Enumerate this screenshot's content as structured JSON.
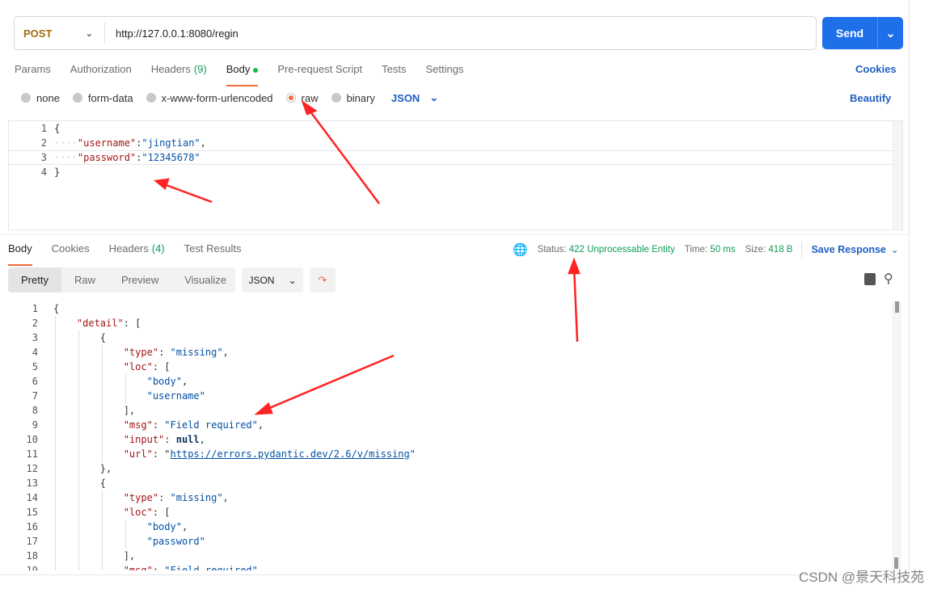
{
  "request": {
    "method": "POST",
    "url": "http://127.0.0.1:8080/regin",
    "send_label": "Send"
  },
  "request_tabs": [
    {
      "label": "Params"
    },
    {
      "label": "Authorization"
    },
    {
      "label": "Headers",
      "count": "(9)"
    },
    {
      "label": "Body",
      "active": true
    },
    {
      "label": "Pre-request Script"
    },
    {
      "label": "Tests"
    },
    {
      "label": "Settings"
    }
  ],
  "cookies_label": "Cookies",
  "body_types": [
    {
      "label": "none"
    },
    {
      "label": "form-data"
    },
    {
      "label": "x-www-form-urlencoded"
    },
    {
      "label": "raw",
      "selected": true
    },
    {
      "label": "binary"
    }
  ],
  "body_format": "JSON",
  "beautify_label": "Beautify",
  "request_body": [
    [
      [
        "p",
        "{"
      ]
    ],
    [
      [
        "ws",
        "····"
      ],
      [
        "k",
        "\"username\""
      ],
      [
        "p",
        ":"
      ],
      [
        "s",
        "\"jingtian\""
      ],
      [
        "p",
        ","
      ]
    ],
    [
      [
        "ws",
        "····"
      ],
      [
        "k",
        "\"password\""
      ],
      [
        "p",
        ":"
      ],
      [
        "s",
        "\"12345678\""
      ]
    ],
    [
      [
        "p",
        "}"
      ]
    ]
  ],
  "response_tabs": [
    {
      "label": "Body",
      "active": true
    },
    {
      "label": "Cookies"
    },
    {
      "label": "Headers",
      "count": "(4)"
    },
    {
      "label": "Test Results"
    }
  ],
  "status": {
    "status_label": "Status:",
    "status_value": "422 Unprocessable Entity",
    "time_label": "Time:",
    "time_value": "50 ms",
    "size_label": "Size:",
    "size_value": "418 B",
    "save_label": "Save Response"
  },
  "view_modes": [
    {
      "label": "Pretty",
      "active": true
    },
    {
      "label": "Raw"
    },
    {
      "label": "Preview"
    },
    {
      "label": "Visualize"
    }
  ],
  "response_format": "JSON",
  "response_body": [
    [
      [
        "p",
        "{"
      ]
    ],
    [
      [
        "p",
        "    "
      ],
      [
        "k",
        "\"detail\""
      ],
      [
        "p",
        ": ["
      ]
    ],
    [
      [
        "p",
        "        {"
      ]
    ],
    [
      [
        "p",
        "            "
      ],
      [
        "k",
        "\"type\""
      ],
      [
        "p",
        ": "
      ],
      [
        "s",
        "\"missing\""
      ],
      [
        "p",
        ","
      ]
    ],
    [
      [
        "p",
        "            "
      ],
      [
        "k",
        "\"loc\""
      ],
      [
        "p",
        ": ["
      ]
    ],
    [
      [
        "p",
        "                "
      ],
      [
        "s",
        "\"body\""
      ],
      [
        "p",
        ","
      ]
    ],
    [
      [
        "p",
        "                "
      ],
      [
        "s",
        "\"username\""
      ]
    ],
    [
      [
        "p",
        "            ],"
      ]
    ],
    [
      [
        "p",
        "            "
      ],
      [
        "k",
        "\"msg\""
      ],
      [
        "p",
        ": "
      ],
      [
        "s",
        "\"Field required\""
      ],
      [
        "p",
        ","
      ]
    ],
    [
      [
        "p",
        "            "
      ],
      [
        "k",
        "\"input\""
      ],
      [
        "p",
        ": "
      ],
      [
        "b",
        "null"
      ],
      [
        "p",
        ","
      ]
    ],
    [
      [
        "p",
        "            "
      ],
      [
        "k",
        "\"url\""
      ],
      [
        "p",
        ": \""
      ],
      [
        "u",
        "https://errors.pydantic.dev/2.6/v/missing"
      ],
      [
        "s",
        "\""
      ]
    ],
    [
      [
        "p",
        "        },"
      ]
    ],
    [
      [
        "p",
        "        {"
      ]
    ],
    [
      [
        "p",
        "            "
      ],
      [
        "k",
        "\"type\""
      ],
      [
        "p",
        ": "
      ],
      [
        "s",
        "\"missing\""
      ],
      [
        "p",
        ","
      ]
    ],
    [
      [
        "p",
        "            "
      ],
      [
        "k",
        "\"loc\""
      ],
      [
        "p",
        ": ["
      ]
    ],
    [
      [
        "p",
        "                "
      ],
      [
        "s",
        "\"body\""
      ],
      [
        "p",
        ","
      ]
    ],
    [
      [
        "p",
        "                "
      ],
      [
        "s",
        "\"password\""
      ]
    ],
    [
      [
        "p",
        "            ],"
      ]
    ],
    [
      [
        "p",
        "            "
      ],
      [
        "k",
        "\"msg\""
      ],
      [
        "p",
        ": "
      ],
      [
        "s",
        "\"Field required\""
      ]
    ]
  ],
  "watermark": "CSDN @景天科技苑",
  "colors": {
    "accent": "#f26b3a",
    "send": "#1f6feb",
    "status_ok": "#0f9d58",
    "method": "#a26d10"
  }
}
